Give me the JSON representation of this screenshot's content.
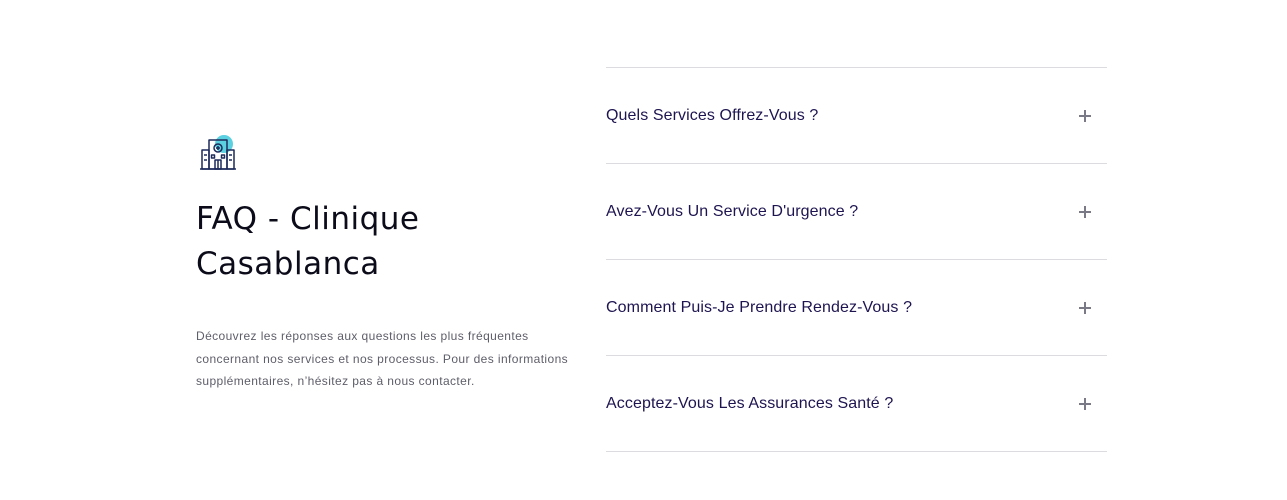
{
  "faq_intro": {
    "icon": "hospital-building-icon",
    "title": "FAQ - Clinique\nCasablanca",
    "description": "Découvrez les réponses aux questions les plus fréquentes concernant nos services et nos processus. Pour des informations supplémentaires, n’hésitez pas à nous contacter."
  },
  "accordion": {
    "items": [
      {
        "question": "Quels Services Offrez-Vous ?",
        "expanded": false
      },
      {
        "question": "Avez-Vous Un Service D'urgence ?",
        "expanded": false
      },
      {
        "question": "Comment Puis-Je Prendre Rendez-Vous ?",
        "expanded": false
      },
      {
        "question": "Acceptez-Vous Les Assurances Santé ?",
        "expanded": false
      }
    ],
    "toggle_icon": "plus-icon"
  },
  "colors": {
    "title": "#0b0b1a",
    "question": "#1e1450",
    "body_text": "#5e5e6a",
    "divider": "#dcdce0",
    "icon_accent": "#5ad0e0",
    "icon_stroke": "#1c2a5a"
  }
}
